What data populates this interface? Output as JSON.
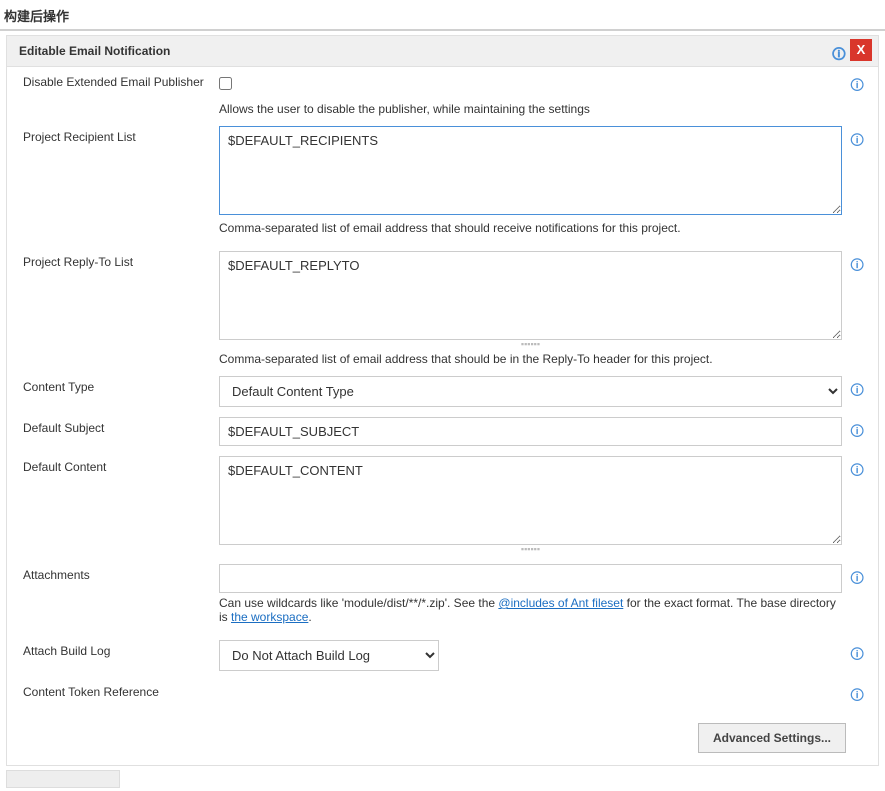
{
  "header": {
    "title": "构建后操作"
  },
  "panel": {
    "title": "Editable Email Notification",
    "close_label": "X"
  },
  "disable_publisher": {
    "label": "Disable Extended Email Publisher",
    "desc": "Allows the user to disable the publisher, while maintaining the settings"
  },
  "recipient_list": {
    "label": "Project Recipient List",
    "value": "$DEFAULT_RECIPIENTS",
    "desc": "Comma-separated list of email address that should receive notifications for this project."
  },
  "replyto_list": {
    "label": "Project Reply-To List",
    "value": "$DEFAULT_REPLYTO",
    "desc": "Comma-separated list of email address that should be in the Reply-To header for this project."
  },
  "content_type": {
    "label": "Content Type",
    "selected": "Default Content Type"
  },
  "default_subject": {
    "label": "Default Subject",
    "value": "$DEFAULT_SUBJECT"
  },
  "default_content": {
    "label": "Default Content",
    "value": "$DEFAULT_CONTENT"
  },
  "attachments": {
    "label": "Attachments",
    "value": "",
    "desc_prefix": "Can use wildcards like 'module/dist/**/*.zip'. See the ",
    "desc_link1": "@includes of Ant fileset",
    "desc_mid": " for the exact format. The base directory is ",
    "desc_link2": "the workspace",
    "desc_suffix": "."
  },
  "attach_build_log": {
    "label": "Attach Build Log",
    "selected": "Do Not Attach Build Log"
  },
  "content_token_ref": {
    "label": "Content Token Reference"
  },
  "advanced": {
    "label": "Advanced Settings..."
  }
}
